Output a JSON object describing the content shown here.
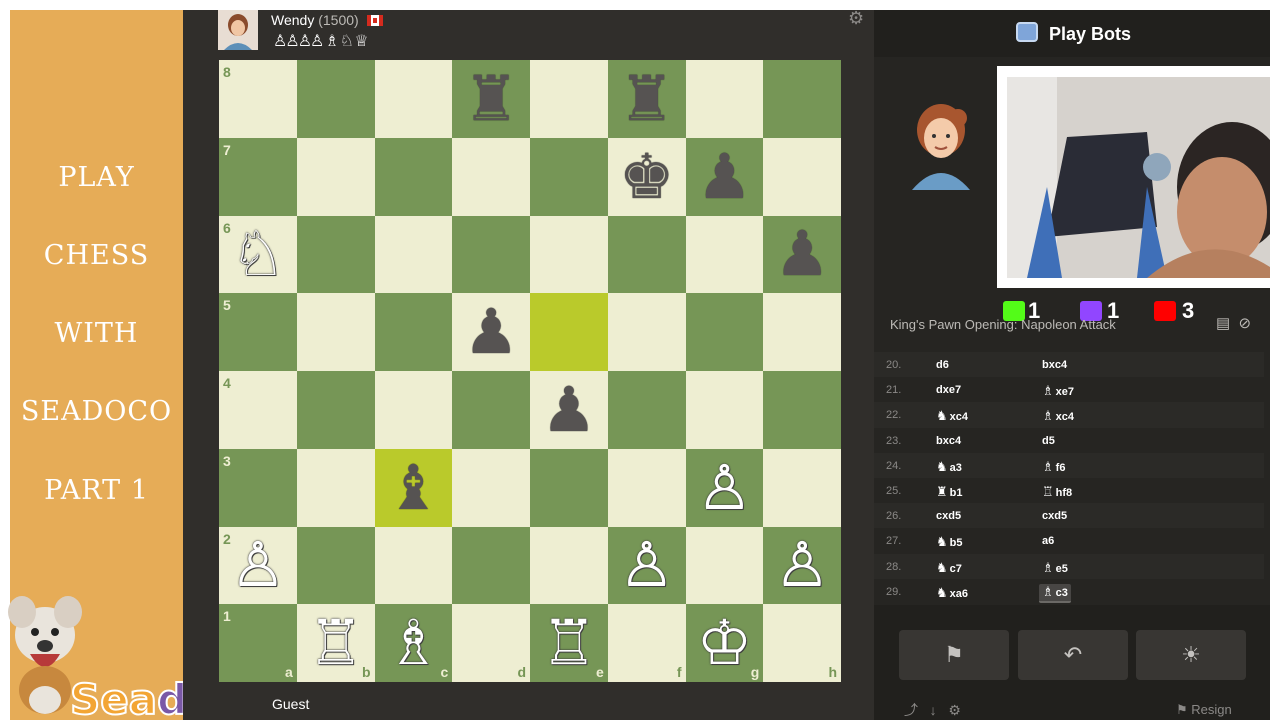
{
  "sidebar": {
    "lines": [
      "PLAY",
      "CHESS",
      "WITH",
      "SEADOCO",
      "PART 1"
    ],
    "logo_prefix": "Sea",
    "logo_suffix": "doco"
  },
  "opponent": {
    "name": "Wendy",
    "rating": "(1500)",
    "captured": "♙♙♙♙ ♗ ♘ ♕"
  },
  "player": {
    "name": "Guest"
  },
  "board": {
    "ranks": [
      "8",
      "7",
      "6",
      "5",
      "4",
      "3",
      "2",
      "1"
    ],
    "files": [
      "a",
      "b",
      "c",
      "d",
      "e",
      "f",
      "g",
      "h"
    ],
    "rows": [
      [
        "",
        "",
        "",
        "bR",
        "",
        "bR",
        "",
        ""
      ],
      [
        "",
        "",
        "",
        "",
        "",
        "bK",
        "bP",
        ""
      ],
      [
        "wN",
        "",
        "",
        "",
        "",
        "",
        "",
        "bP"
      ],
      [
        "",
        "",
        "",
        "bP",
        "",
        "",
        "",
        ""
      ],
      [
        "",
        "",
        "",
        "",
        "bP",
        "",
        "",
        ""
      ],
      [
        "",
        "",
        "bB",
        "",
        "",
        "",
        "wP",
        ""
      ],
      [
        "wP",
        "",
        "",
        "",
        "",
        "wP",
        "",
        "wP"
      ],
      [
        "",
        "wR",
        "wB",
        "",
        "wR",
        "",
        "wK",
        ""
      ]
    ],
    "highlights": [
      "e5",
      "c3"
    ]
  },
  "panel": {
    "title": "Play Bots",
    "opening": "King's Pawn Opening: Napoleon Attack",
    "stats": {
      "kick": "1",
      "twitch": "1",
      "youtube": "3"
    },
    "stat_colors": {
      "kick": "#53fc18",
      "twitch": "#9146ff",
      "youtube": "#ff0000"
    }
  },
  "moves": [
    {
      "num": "20.",
      "w": "d6",
      "wfig": "",
      "b": "bxc4",
      "bfig": ""
    },
    {
      "num": "21.",
      "w": "dxe7",
      "wfig": "",
      "b": "xe7",
      "bfig": "♗"
    },
    {
      "num": "22.",
      "w": "xc4",
      "wfig": "♞",
      "b": "xc4",
      "bfig": "♗"
    },
    {
      "num": "23.",
      "w": "bxc4",
      "wfig": "",
      "b": "d5",
      "bfig": ""
    },
    {
      "num": "24.",
      "w": "a3",
      "wfig": "♞",
      "b": "f6",
      "bfig": "♗"
    },
    {
      "num": "25.",
      "w": "b1",
      "wfig": "♜",
      "b": "hf8",
      "bfig": "♖"
    },
    {
      "num": "26.",
      "w": "cxd5",
      "wfig": "",
      "b": "cxd5",
      "bfig": ""
    },
    {
      "num": "27.",
      "w": "b5",
      "wfig": "♞",
      "b": "a6",
      "bfig": ""
    },
    {
      "num": "28.",
      "w": "c7",
      "wfig": "♞",
      "b": "e5",
      "bfig": "♗"
    },
    {
      "num": "29.",
      "w": "xa6",
      "wfig": "♞",
      "b": "c3",
      "bfig": "♗"
    }
  ],
  "actions": {
    "resign_label": "Resign"
  }
}
